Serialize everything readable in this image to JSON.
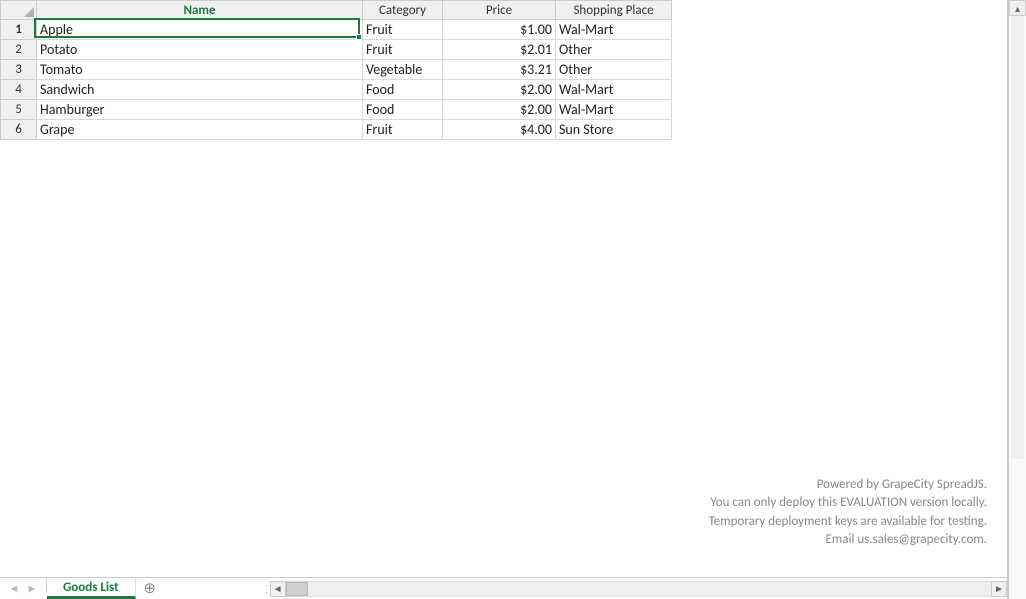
{
  "columns": {
    "name": "Name",
    "category": "Category",
    "price": "Price",
    "shopping_place": "Shopping Place"
  },
  "row_numbers": [
    "1",
    "2",
    "3",
    "4",
    "5",
    "6"
  ],
  "rows": [
    {
      "name": "Apple",
      "category": "Fruit",
      "price": "$1.00",
      "place": "Wal-Mart"
    },
    {
      "name": "Potato",
      "category": "Fruit",
      "price": "$2.01",
      "place": "Other"
    },
    {
      "name": "Tomato",
      "category": "Vegetable",
      "price": "$3.21",
      "place": "Other"
    },
    {
      "name": "Sandwich",
      "category": "Food",
      "price": "$2.00",
      "place": "Wal-Mart"
    },
    {
      "name": "Hamburger",
      "category": "Food",
      "price": "$2.00",
      "place": "Wal-Mart"
    },
    {
      "name": "Grape",
      "category": "Fruit",
      "price": "$4.00",
      "place": "Sun Store"
    }
  ],
  "notice": {
    "line1": "Powered by GrapeCity SpreadJS.",
    "line2": "You can only deploy this EVALUATION version locally.",
    "line3": "Temporary deployment keys are available for testing.",
    "line4": "Email us.sales@grapecity.com."
  },
  "tabs": {
    "active": "Goods List"
  },
  "icons": {
    "nav_first": "◄",
    "nav_prev": "◄",
    "nav_next": "►",
    "nav_last": "►",
    "add_tab": "⊕",
    "divider": "⋮",
    "scroll_left": "◄",
    "scroll_right": "►",
    "scroll_up": "▴"
  }
}
